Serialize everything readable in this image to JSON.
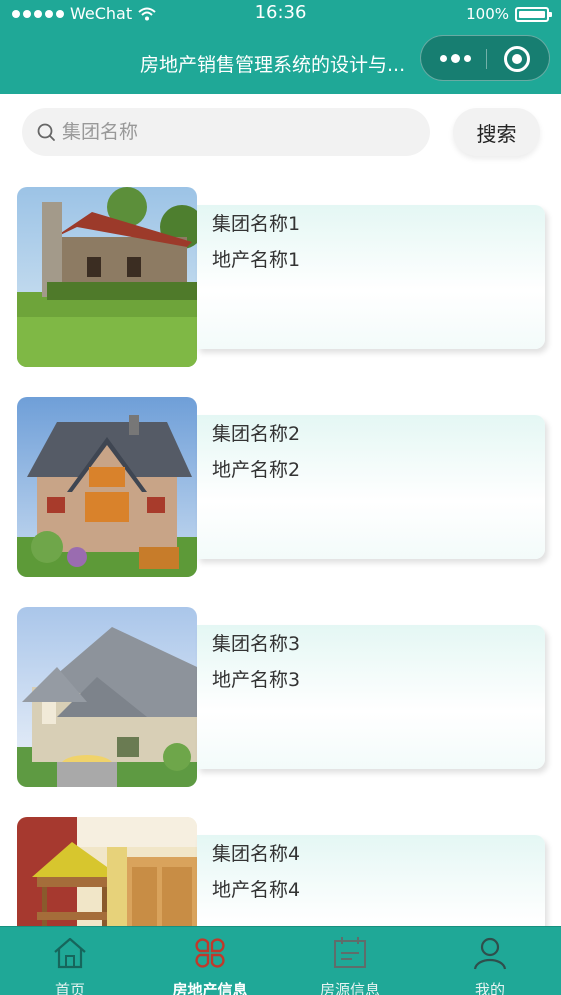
{
  "status_bar": {
    "carrier": "WeChat",
    "time": "16:36",
    "battery": "100%"
  },
  "nav": {
    "title": "房地产销售管理系统的设计与..."
  },
  "search": {
    "placeholder": "集团名称",
    "button_label": "搜索"
  },
  "items": [
    {
      "group_name": "集团名称1",
      "estate_name": "地产名称1",
      "image": "log-cabin-house-photo"
    },
    {
      "group_name": "集团名称2",
      "estate_name": "地产名称2",
      "image": "brick-house-photo"
    },
    {
      "group_name": "集团名称3",
      "estate_name": "地产名称3",
      "image": "villa-rendering-photo"
    },
    {
      "group_name": "集团名称4",
      "estate_name": "地产名称4",
      "image": "kids-bedroom-photo"
    }
  ],
  "tabbar": {
    "active_index": 1,
    "tabs": [
      {
        "label": "首页",
        "icon": "home-icon"
      },
      {
        "label": "房地产信息",
        "icon": "grid-flower-icon"
      },
      {
        "label": "房源信息",
        "icon": "calendar-icon"
      },
      {
        "label": "我的",
        "icon": "user-icon"
      }
    ]
  },
  "colors": {
    "primary": "#1fa897",
    "active_icon": "#c0392b"
  }
}
